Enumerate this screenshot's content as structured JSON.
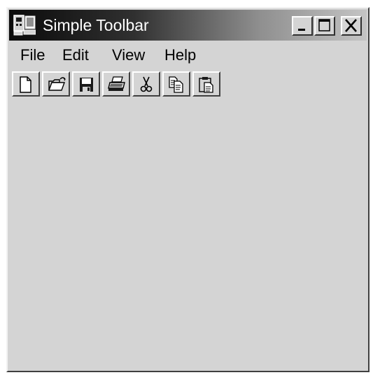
{
  "window": {
    "title": "Simple Toolbar",
    "app_icon": "window-app-icon"
  },
  "caption_buttons": {
    "minimize_icon": "minimize-icon",
    "maximize_icon": "maximize-icon",
    "close_icon": "close-icon"
  },
  "menu": {
    "items": [
      {
        "label": "File"
      },
      {
        "label": "Edit"
      },
      {
        "label": "View"
      },
      {
        "label": "Help"
      }
    ]
  },
  "toolbar": {
    "buttons": [
      {
        "icon": "new-file-icon"
      },
      {
        "icon": "open-folder-icon"
      },
      {
        "icon": "save-disk-icon"
      },
      {
        "icon": "printer-icon"
      },
      {
        "icon": "scissors-cut-icon"
      },
      {
        "icon": "copy-icon"
      },
      {
        "icon": "paste-clipboard-icon"
      }
    ]
  },
  "colors": {
    "window_face": "#d4d4d4",
    "titlebar_start": "#0a0a0a",
    "titlebar_end": "#c4c4c4",
    "title_text": "#ffffff"
  }
}
